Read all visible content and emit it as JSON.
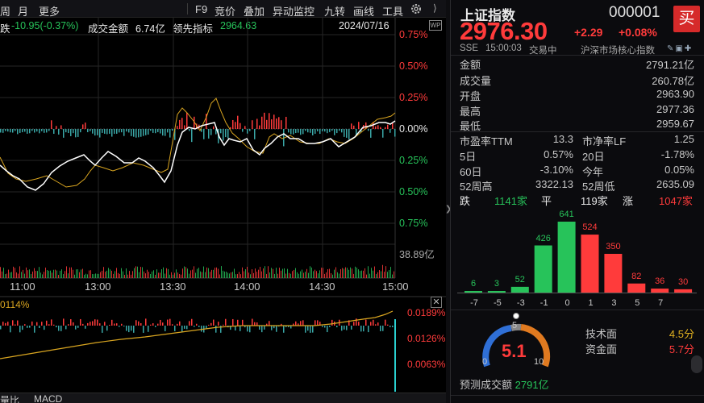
{
  "toolbar": {
    "items": [
      "周",
      "月",
      "更多",
      "F9",
      "竞价",
      "叠加",
      "异动监控",
      "九转",
      "画线",
      "工具"
    ]
  },
  "info": {
    "change_prefix": "跌",
    "change": "-10.95(-0.37%)",
    "turnover_label": "成交金额",
    "turnover": "6.74亿",
    "lead_label": "领先指标",
    "lead_value": "2964.63",
    "date": "2024/07/16"
  },
  "axis": {
    "pct_labels": [
      "0.75%",
      "0.50%",
      "0.25%",
      "0.00%",
      "0.25%",
      "0.50%",
      "0.75%"
    ],
    "volume_label": "38.89亿",
    "time_labels": [
      "11:00",
      "13:00",
      "13:30",
      "14:00",
      "14:30",
      "15:00"
    ],
    "lower_left": "0114%",
    "lower_labels": [
      "0.0189%",
      "0.0126%",
      "0.0063%"
    ],
    "bottom_tabs": [
      "量比",
      "MACD"
    ]
  },
  "quote": {
    "name": "上证指数",
    "code": "000001",
    "buy_label": "买",
    "price": "2976.30",
    "change": "+2.29",
    "change_pct": "+0.08%",
    "exchange": "SSE",
    "time": "15:00:03",
    "status": "交易中",
    "category": "沪深市场核心指数"
  },
  "stats": [
    {
      "label": "金额",
      "value": "2791.21亿",
      "color": "#e8e8e8"
    },
    {
      "label": "成交量",
      "value": "260.78亿",
      "color": "#e8e8e8"
    },
    {
      "label": "开盘",
      "value": "2963.90",
      "color": "#27c35a"
    },
    {
      "label": "最高",
      "value": "2977.36",
      "color": "#ff3b3b"
    },
    {
      "label": "最低",
      "value": "2959.67",
      "color": "#27c35a"
    }
  ],
  "grid": [
    {
      "l1": "市盈率TTM",
      "v1": "13.3",
      "c1": "#e8e8e8",
      "l2": "市净率LF",
      "v2": "1.25",
      "c2": "#e8e8e8"
    },
    {
      "l1": "5日",
      "v1": "0.57%",
      "c1": "#ff3b3b",
      "l2": "20日",
      "v2": "-1.78%",
      "c2": "#27c35a"
    },
    {
      "l1": "60日",
      "v1": "-3.10%",
      "c1": "#27c35a",
      "l2": "今年",
      "v2": "0.05%",
      "c2": "#ff3b3b"
    },
    {
      "l1": "52周高",
      "v1": "3322.13",
      "c1": "#e8e8e8",
      "l2": "52周低",
      "v2": "2635.09",
      "c2": "#e8e8e8"
    }
  ],
  "breadth": {
    "down_label": "跌",
    "down": "1141家",
    "flat_label": "平",
    "flat": "119家",
    "up_label": "涨",
    "up": "1047家"
  },
  "distribution": {
    "ticks": [
      "-7",
      "-5",
      "-3",
      "-1",
      "0",
      "1",
      "3",
      "5",
      "7"
    ],
    "bars": [
      {
        "value": 6,
        "color": "#27c35a"
      },
      {
        "value": 3,
        "color": "#27c35a"
      },
      {
        "value": 52,
        "color": "#27c35a"
      },
      {
        "value": 426,
        "color": "#27c35a"
      },
      {
        "value": 641,
        "color": "#27c35a"
      },
      {
        "value": 524,
        "color": "#ff3b3b"
      },
      {
        "value": 350,
        "color": "#ff3b3b"
      },
      {
        "value": 82,
        "color": "#ff3b3b"
      },
      {
        "value": 36,
        "color": "#ff3b3b"
      },
      {
        "value": 30,
        "color": "#ff3b3b"
      }
    ]
  },
  "score": {
    "value": "5.1",
    "gauge_min": "0",
    "gauge_mid": "5",
    "gauge_max": "10",
    "tech_label": "技术面",
    "tech_value": "4.5分",
    "fund_label": "资金面",
    "fund_value": "5.7分"
  },
  "forecast": {
    "label": "预测成交额",
    "value": "2791亿"
  }
}
